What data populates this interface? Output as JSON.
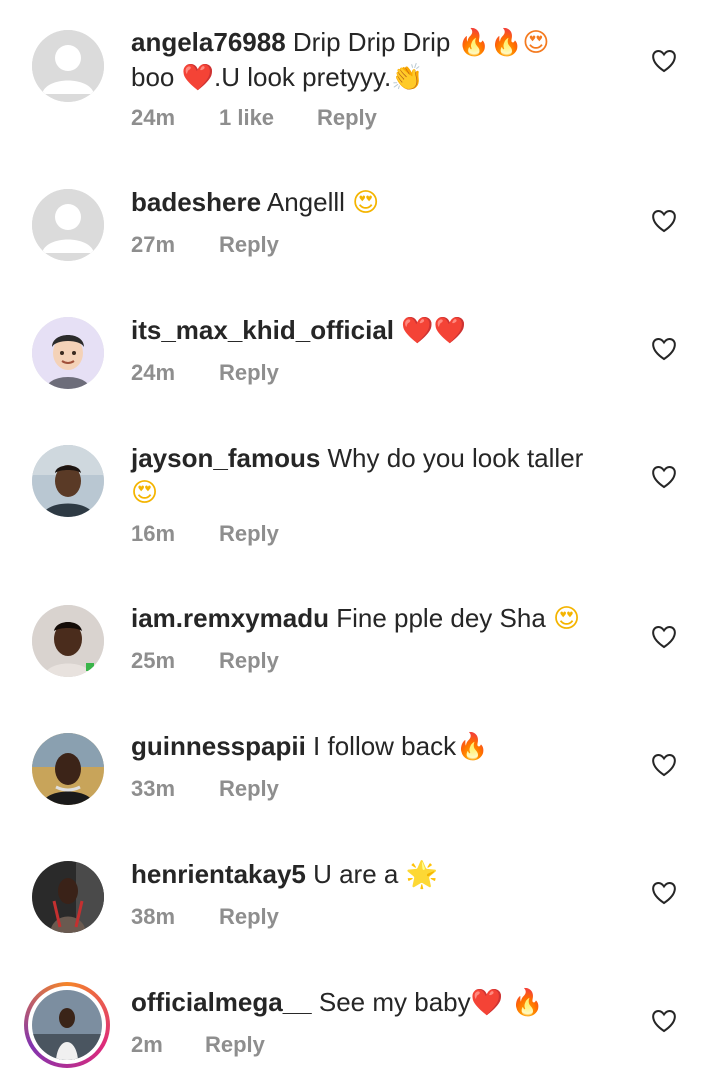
{
  "comments": [
    {
      "username": "angela76988",
      "text_before": " Drip Drip Drip ",
      "emojis": "🔥🔥😍",
      "line2": "boo ",
      "emoji2": "❤️",
      "line2_after": ".U look pretyyy.",
      "emoji3": "👏",
      "time": "24m",
      "likes": "1 like",
      "reply": "Reply",
      "avatar": "default"
    },
    {
      "username": "badeshere",
      "text": " Angelll ",
      "emoji": "😍",
      "time": "27m",
      "reply": "Reply",
      "avatar": "default"
    },
    {
      "username": "its_max_khid_official",
      "text": " ",
      "emoji": "❤️❤️",
      "time": "24m",
      "reply": "Reply",
      "avatar": "cartoon"
    },
    {
      "username": "jayson_famous",
      "text": " Why do you look taller",
      "emoji": "😍",
      "time": "16m",
      "reply": "Reply",
      "avatar": "photo"
    },
    {
      "username": "iam.remxymadu",
      "text": " Fine pple dey Sha ",
      "emoji": "😍",
      "time": "25m",
      "reply": "Reply",
      "avatar": "photo"
    },
    {
      "username": "guinnesspapii",
      "text": " I follow back",
      "emoji": "🔥",
      "time": "33m",
      "reply": "Reply",
      "avatar": "photo"
    },
    {
      "username": "henrientakay5",
      "text": " U are a ",
      "emoji": "🌟",
      "time": "38m",
      "reply": "Reply",
      "avatar": "photo"
    },
    {
      "username": "officialmega__",
      "text": " See my baby",
      "emoji": "❤️ 🔥",
      "time": "2m",
      "reply": "Reply",
      "avatar": "story"
    }
  ],
  "icons": {
    "like": "heart-outline-icon",
    "default_avatar": "person-silhouette-icon"
  },
  "colors": {
    "text": "#262626",
    "meta": "#8e8e8e",
    "avatar_bg": "#dbdbdb",
    "story_ring": "#dd2a7b"
  }
}
